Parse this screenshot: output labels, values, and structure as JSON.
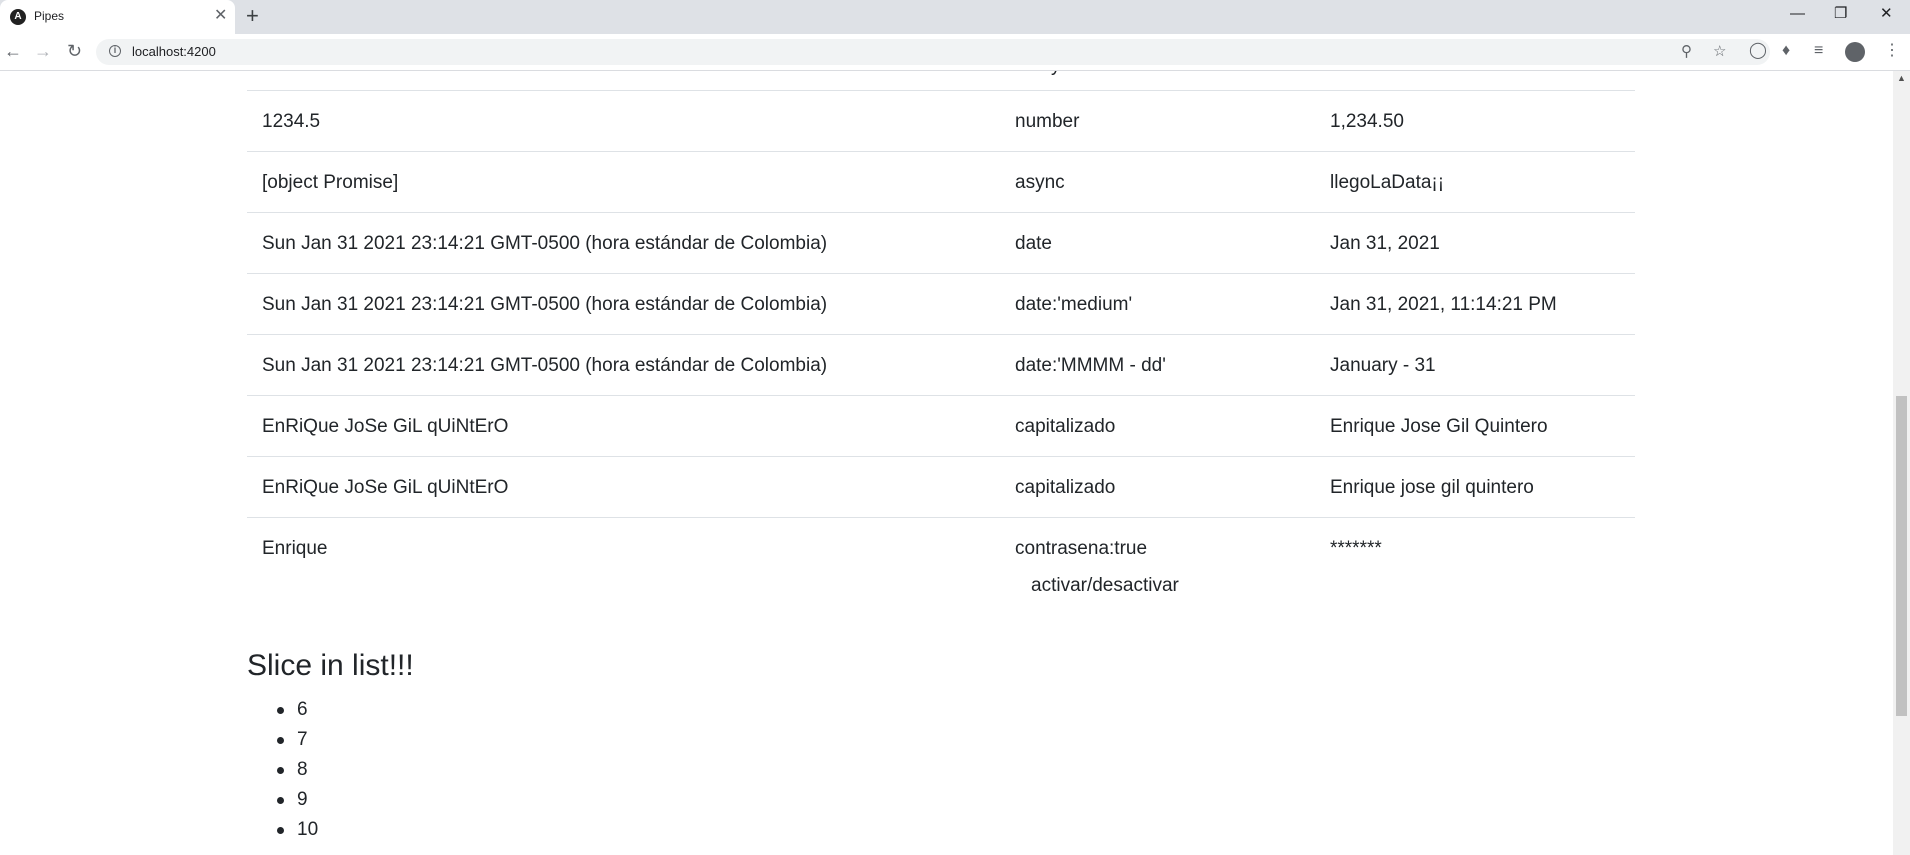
{
  "browser": {
    "tab_title": "Pipes",
    "tab_favicon_letter": "A",
    "url": "localhost:4200",
    "icons": {
      "back": "arrow-left-icon",
      "forward": "arrow-right-icon",
      "reload": "reload-icon",
      "zoom": "zoom-icon",
      "bookmark": "star-icon",
      "extensions": "puzzle-icon",
      "reading_list": "list-icon",
      "profile": "avatar-icon",
      "menu": "kebab-menu-icon"
    }
  },
  "table": {
    "partial_top_text": "y",
    "rows": [
      {
        "value": "1234.5",
        "pipe": "number",
        "result": "1,234.50"
      },
      {
        "value": "[object Promise]",
        "pipe": "async",
        "result": "llegoLaData¡¡"
      },
      {
        "value": "Sun Jan 31 2021 23:14:21 GMT-0500 (hora estándar de Colombia)",
        "pipe": "date",
        "result": "Jan 31, 2021"
      },
      {
        "value": "Sun Jan 31 2021 23:14:21 GMT-0500 (hora estándar de Colombia)",
        "pipe": "date:'medium'",
        "result": "Jan 31, 2021, 11:14:21 PM"
      },
      {
        "value": "Sun Jan 31 2021 23:14:21 GMT-0500 (hora estándar de Colombia)",
        "pipe": "date:'MMMM - dd'",
        "result": "January - 31"
      },
      {
        "value": "EnRiQue JoSe GiL qUiNtErO",
        "pipe": "capitalizado",
        "result": "Enrique Jose Gil Quintero"
      },
      {
        "value": "EnRiQue JoSe GiL qUiNtErO",
        "pipe": "capitalizado",
        "result": "Enrique jose gil quintero"
      },
      {
        "value": "Enrique",
        "pipe": "contrasena:true",
        "result": "*******"
      }
    ],
    "toggle_label": "activar/desactivar"
  },
  "slice_section": {
    "title": "Slice in list!!!",
    "items": [
      "6",
      "7",
      "8",
      "9",
      "10"
    ]
  }
}
